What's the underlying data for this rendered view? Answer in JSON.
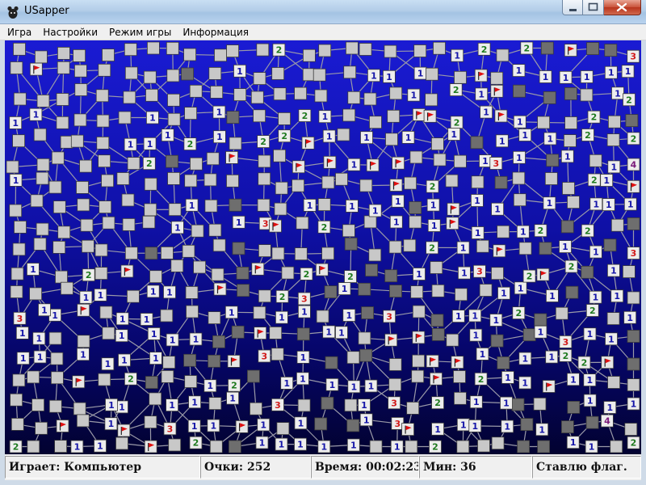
{
  "window": {
    "title": "USapper",
    "icons": {
      "app": "mouse-icon",
      "minimize": "minimize-icon",
      "maximize": "maximize-icon",
      "close": "close-icon"
    }
  },
  "menu": [
    {
      "label": "Игра"
    },
    {
      "label": "Настройки"
    },
    {
      "label": "Режим игры"
    },
    {
      "label": "Информация"
    }
  ],
  "status": {
    "player": "Играет: Компьютер",
    "score": "Очки: 252",
    "time": "Время: 00:02:23",
    "mines": "Мин: 36",
    "action": "Ставлю флаг."
  },
  "colors": {
    "unopened": "#c8c8c8",
    "opened": "#6e6e6e",
    "number_1": "#1515a8",
    "number_2": "#1f7a1f",
    "number_3": "#d11a1a",
    "number_4": "#7a1a7a",
    "flag": "#e01010",
    "edge": "#9a9aa8"
  },
  "board": {
    "flagged_count": 40,
    "numbered_cells": {
      "1": 150,
      "2": 38,
      "3": 14,
      "4": 2
    }
  }
}
